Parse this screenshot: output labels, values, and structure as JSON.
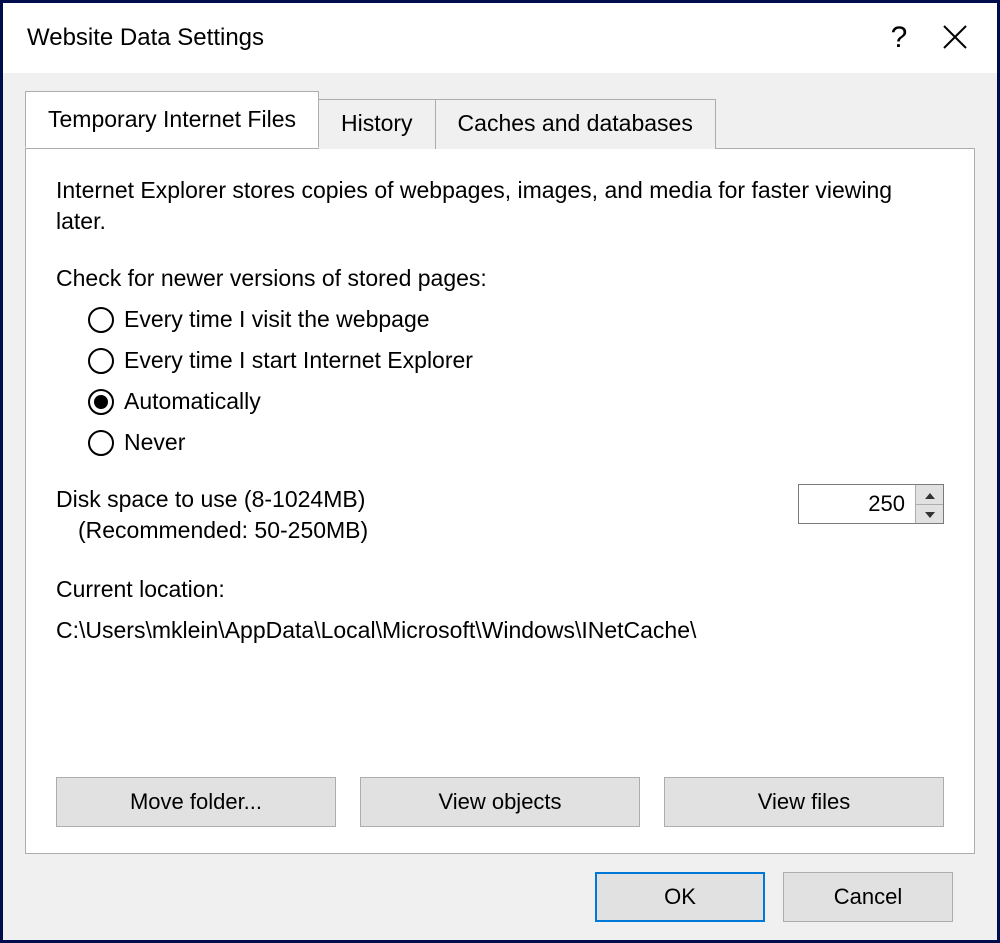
{
  "window": {
    "title": "Website Data Settings"
  },
  "tabs": [
    {
      "label": "Temporary Internet Files",
      "active": true
    },
    {
      "label": "History",
      "active": false
    },
    {
      "label": "Caches and databases",
      "active": false
    }
  ],
  "intro": "Internet Explorer stores copies of webpages, images, and media for faster viewing later.",
  "check_newer": {
    "label": "Check for newer versions of stored pages:",
    "options": [
      {
        "label": "Every time I visit the webpage",
        "checked": false
      },
      {
        "label": "Every time I start Internet Explorer",
        "checked": false
      },
      {
        "label": "Automatically",
        "checked": true
      },
      {
        "label": "Never",
        "checked": false
      }
    ]
  },
  "disk_space": {
    "label": "Disk space to use (8-1024MB)",
    "recommended": "(Recommended: 50-250MB)",
    "value": "250"
  },
  "current_location": {
    "label": "Current location:",
    "path": "C:\\Users\\mklein\\AppData\\Local\\Microsoft\\Windows\\INetCache\\"
  },
  "buttons": {
    "move_folder": "Move folder...",
    "view_objects": "View objects",
    "view_files": "View files",
    "ok": "OK",
    "cancel": "Cancel"
  }
}
